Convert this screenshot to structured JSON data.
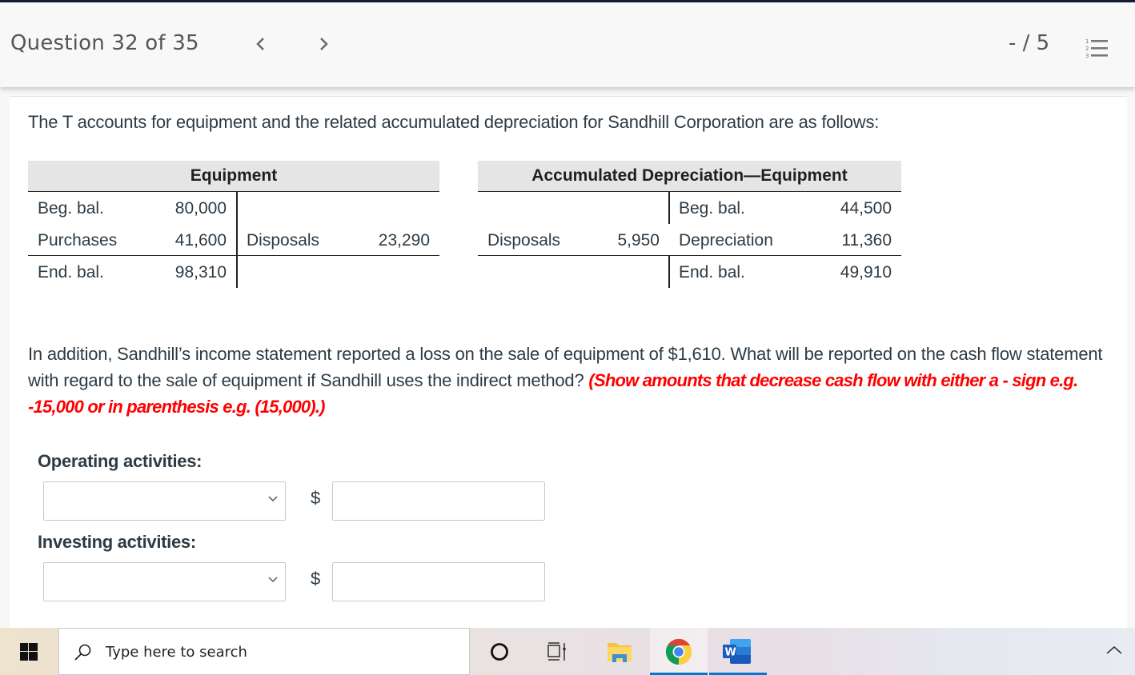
{
  "header": {
    "question_title": "Question 32 of 35",
    "prev_label": "<",
    "next_label": ">",
    "score": "- / 5",
    "question_list_icon": "numbered-list-icon"
  },
  "question": {
    "intro": "The T accounts for equipment and the related accumulated depreciation for Sandhill Corporation are as follows:",
    "paragraph_main": "In addition, Sandhill’s income statement reported a loss on the sale of equipment of $1,610. What will be reported on the cash flow statement with regard to the sale of equipment if Sandhill uses the indirect method? ",
    "paragraph_instruction": "(Show amounts that decrease cash flow with either a - sign e.g. -15,000 or in parenthesis e.g. (15,000).)"
  },
  "t_accounts": {
    "equipment": {
      "title": "Equipment",
      "rows": [
        {
          "debit_label": "Beg. bal.",
          "debit_value": "80,000",
          "credit_label": "",
          "credit_value": ""
        },
        {
          "debit_label": "Purchases",
          "debit_value": "41,600",
          "credit_label": "Disposals",
          "credit_value": "23,290"
        },
        {
          "debit_label": "End. bal.",
          "debit_value": "98,310",
          "credit_label": "",
          "credit_value": ""
        }
      ]
    },
    "accumulated_depreciation": {
      "title": "Accumulated Depreciation—Equipment",
      "rows": [
        {
          "debit_label": "",
          "debit_value": "",
          "credit_label": "Beg. bal.",
          "credit_value": "44,500"
        },
        {
          "debit_label": "Disposals",
          "debit_value": "5,950",
          "credit_label": "Depreciation",
          "credit_value": "11,360"
        },
        {
          "debit_label": "",
          "debit_value": "",
          "credit_label": "End. bal.",
          "credit_value": "49,910"
        }
      ]
    }
  },
  "answer_form": {
    "operating": {
      "label": "Operating activities:",
      "select_value": "",
      "currency_symbol": "$",
      "amount_value": ""
    },
    "investing": {
      "label": "Investing activities:",
      "select_value": "",
      "currency_symbol": "$",
      "amount_value": ""
    }
  },
  "taskbar": {
    "search_placeholder": "Type here to search",
    "icons": [
      "windows-start-icon",
      "search-icon",
      "cortana-icon",
      "task-view-icon",
      "file-explorer-icon",
      "chrome-icon",
      "word-icon",
      "chevron-up-icon"
    ],
    "word_icon_letter": "W"
  },
  "colors": {
    "instruction_red": "#ff0000",
    "header_top_bar": "#141c3a",
    "taskbar_active": "#0078d4"
  }
}
